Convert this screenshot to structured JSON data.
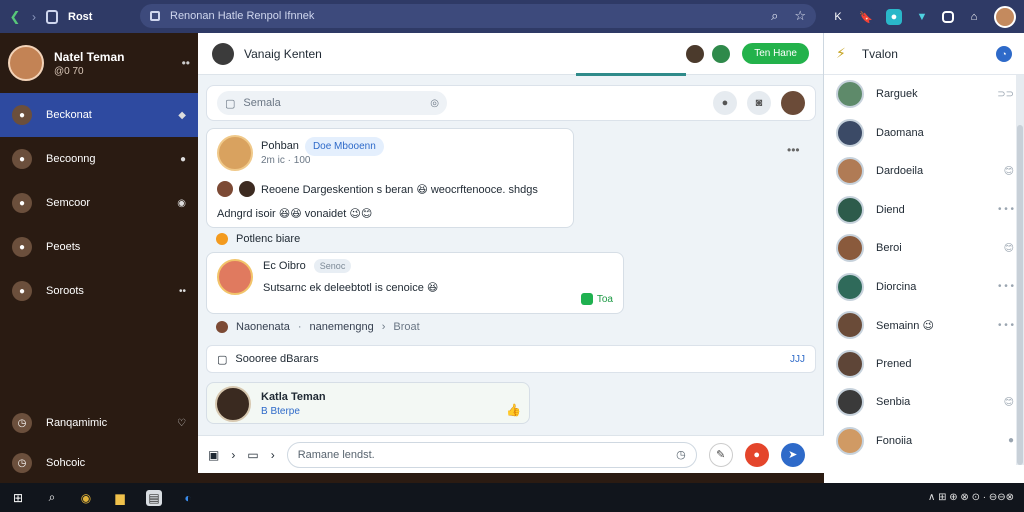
{
  "browser": {
    "tab_title": "Rost",
    "address": "Renonan Hatle Renpol Ifnnek",
    "address_icons": [
      "search-icon",
      "star-icon"
    ],
    "extensions": [
      "K",
      "🔖",
      "💬",
      "▼",
      "▣",
      "🎁"
    ]
  },
  "sidebar": {
    "profile": {
      "name": "Natel Teman",
      "sub": "@0 70"
    },
    "items": [
      {
        "label": "Beckonat",
        "icon": "home-icon",
        "active": true,
        "trail": "◆"
      },
      {
        "label": "Becoonng",
        "icon": "inbox-icon",
        "active": false,
        "trail": "●"
      },
      {
        "label": "Semcoor",
        "icon": "user-icon",
        "active": false,
        "trail": "◉"
      },
      {
        "label": "Peoets",
        "icon": "building-icon",
        "active": false,
        "trail": ""
      },
      {
        "label": "Soroots",
        "icon": "people-icon",
        "active": false,
        "trail": "••"
      }
    ],
    "footer": [
      {
        "label": "Ranqamimic",
        "icon": "globe-icon",
        "trail": "♡"
      },
      {
        "label": "Sohcoic",
        "icon": "clock-icon",
        "trail": ""
      }
    ]
  },
  "main": {
    "header": {
      "title": "Vanaig Kenten",
      "action": "Ten Hane"
    },
    "search": {
      "placeholder": "Semala"
    },
    "post1": {
      "author": "Pohban",
      "chip": "Doe Mbooenn",
      "time": "2m ic  ·  100",
      "line1": "Reoene Dargeskention s beran 😆 weocrftenooce. shdgs",
      "line2": "Adngrd isoir 😆😆 vonaidet 😉😊"
    },
    "react_row": "Potlenc biare",
    "post2": {
      "author": "Ec Oibro",
      "tag": "Senoc",
      "body": "Sutsarnc ek deleebtotl is cenoice 😆",
      "badge": "Toa"
    },
    "crumbs": {
      "a": "Naonenata",
      "b": "nanemengng",
      "c": "Broat"
    },
    "summary": {
      "text": "Soooree dBarars",
      "right": "JJJ"
    },
    "reply": {
      "author": "Katla Teman",
      "sub": "B  Bterpe"
    },
    "composer": {
      "placeholder": "Ramane lendst."
    }
  },
  "right": {
    "title": "Tvalon",
    "contacts": [
      {
        "name": "Rarguek",
        "meta": "⊃⊃",
        "color": "#5e8a6a"
      },
      {
        "name": "Daomana",
        "meta": "",
        "color": "#3b4a66"
      },
      {
        "name": "Dardoeila",
        "meta": "😊",
        "color": "#b07b55"
      },
      {
        "name": "Diend",
        "meta": "• • •",
        "color": "#2d5b4b"
      },
      {
        "name": "Beroi",
        "meta": "😊",
        "color": "#8a5a3c"
      },
      {
        "name": "Diorcina",
        "meta": "• • •",
        "color": "#2f6a5a"
      },
      {
        "name": "Semainn 😉",
        "meta": "• • •",
        "color": "#6a4b38"
      },
      {
        "name": "Prened",
        "meta": "",
        "color": "#5e4537"
      },
      {
        "name": "Senbia",
        "meta": "😊",
        "color": "#3a3a3a"
      },
      {
        "name": "Fonoiia",
        "meta": "●",
        "color": "#d09a64"
      }
    ]
  },
  "taskbar": {
    "tray": "∧ ⊞ ⊕ ⊗ ⊙  ·  ⊖⊖⊗"
  }
}
